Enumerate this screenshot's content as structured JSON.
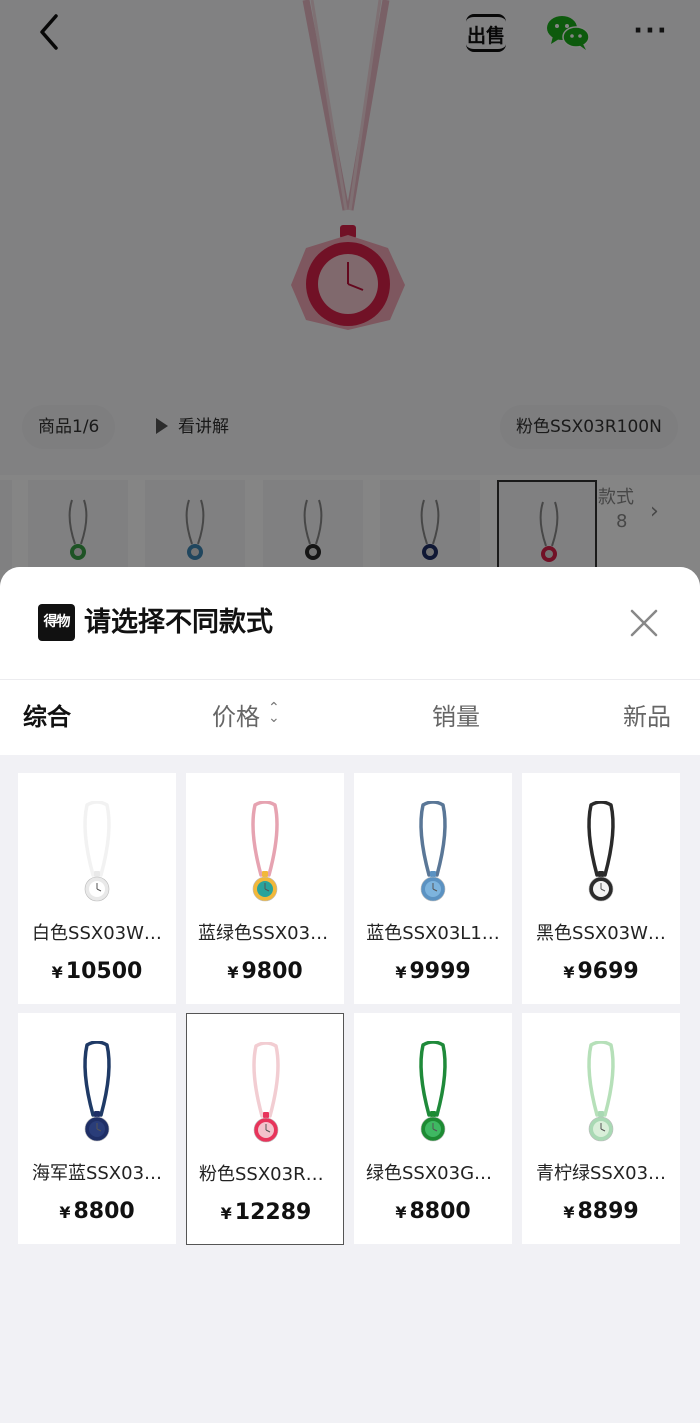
{
  "header": {
    "sell_label": "出售",
    "more_label": "···"
  },
  "hero": {
    "product_counter": "商品1/6",
    "explain_label": "看讲解",
    "variant_label": "粉色SSX03R100N"
  },
  "thumbnails": {
    "colors": [
      "#3aa047",
      "#3f87b5",
      "#2a2a2a",
      "#1f2f66",
      "#d8224a"
    ],
    "selected_index": 4,
    "styles_label": "款式",
    "styles_count": "8"
  },
  "sheet": {
    "logo_text": "得物",
    "title": "请选择不同款式"
  },
  "sort_tabs": {
    "all": "综合",
    "price": "价格",
    "sales": "销量",
    "new": "新品"
  },
  "products": [
    {
      "name": "白色SSX03W…",
      "price": "10500",
      "strap": "#f2f2f2",
      "case": "#e9e9e9",
      "dial": "#ffffff"
    },
    {
      "name": "蓝绿色SSX03J…",
      "price": "9800",
      "strap": "#e6a3b1",
      "case": "#f2b83a",
      "dial": "#2aa39b"
    },
    {
      "name": "蓝色SSX03L1…",
      "price": "9999",
      "strap": "#5a7797",
      "case": "#5b92c2",
      "dial": "#7db3dd"
    },
    {
      "name": "黑色SSX03W…",
      "price": "9699",
      "strap": "#2a2a2a",
      "case": "#2b2b2b",
      "dial": "#f3f3f3"
    },
    {
      "name": "海军蓝SSX03…",
      "price": "8800",
      "strap": "#1f3a66",
      "case": "#1f2f66",
      "dial": "#2a3d79"
    },
    {
      "name": "粉色SSX03R1…",
      "price": "12289",
      "strap": "#f2cdd2",
      "case": "#e8345b",
      "dial": "#f3c2cc"
    },
    {
      "name": "绿色SSX03G1…",
      "price": "8800",
      "strap": "#1f8a3a",
      "case": "#1d8b33",
      "dial": "#3fb862"
    },
    {
      "name": "青柠绿SSX03…",
      "price": "8899",
      "strap": "#b6e0b9",
      "case": "#a9d9b4",
      "dial": "#d9efd9"
    }
  ],
  "selected_product_index": 5,
  "currency_symbol": "¥"
}
